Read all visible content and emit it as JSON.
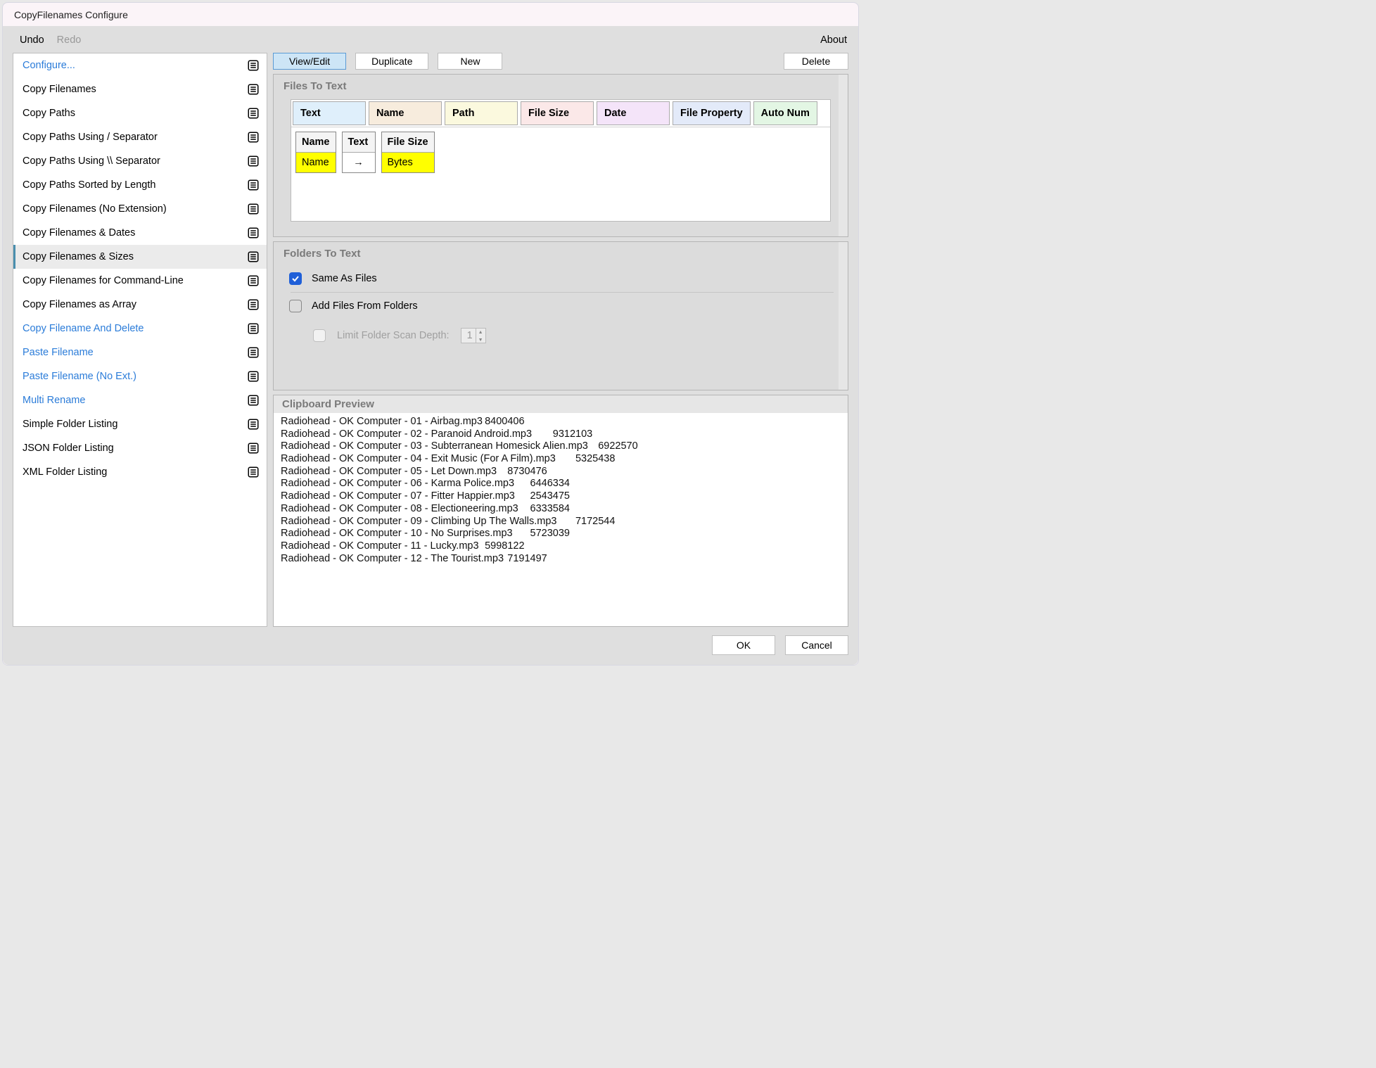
{
  "window_title": "CopyFilenames Configure",
  "menu": {
    "undo": "Undo",
    "redo": "Redo",
    "about": "About"
  },
  "sidebar": {
    "items": [
      {
        "label": "Configure...",
        "link": true
      },
      {
        "label": "Copy Filenames"
      },
      {
        "label": "Copy Paths"
      },
      {
        "label": "Copy Paths Using / Separator"
      },
      {
        "label": "Copy Paths Using \\\\ Separator"
      },
      {
        "label": "Copy Paths Sorted by Length"
      },
      {
        "label": "Copy Filenames (No Extension)"
      },
      {
        "label": "Copy Filenames & Dates"
      },
      {
        "label": "Copy Filenames & Sizes",
        "selected": true
      },
      {
        "label": "Copy Filenames for Command-Line"
      },
      {
        "label": "Copy Filenames as Array"
      },
      {
        "label": "Copy Filename And Delete",
        "link": true
      },
      {
        "label": "Paste Filename",
        "link": true
      },
      {
        "label": "Paste Filename (No Ext.)",
        "link": true
      },
      {
        "label": "Multi Rename",
        "link": true
      },
      {
        "label": "Simple Folder Listing"
      },
      {
        "label": "JSON Folder Listing"
      },
      {
        "label": "XML Folder Listing"
      }
    ]
  },
  "toolbar": {
    "view_edit": "View/Edit",
    "duplicate": "Duplicate",
    "new": "New",
    "delete": "Delete"
  },
  "files_panel": {
    "title": "Files To Text",
    "headers": {
      "text": "Text",
      "name": "Name",
      "path": "Path",
      "size": "File Size",
      "date": "Date",
      "prop": "File Property",
      "anum": "Auto Num"
    },
    "sequence": [
      {
        "head": "Name",
        "val": "Name"
      },
      {
        "head": "Text",
        "val": "→",
        "arrow": true
      },
      {
        "head": "File Size",
        "val": "Bytes"
      }
    ]
  },
  "folders_panel": {
    "title": "Folders To Text",
    "same_as_files": "Same As Files",
    "add_files": "Add Files From Folders",
    "limit_depth": "Limit Folder Scan Depth:",
    "depth_value": "1"
  },
  "preview": {
    "title": "Clipboard Preview",
    "lines": [
      "Radiohead - OK Computer - 01 - Airbag.mp3\t8400406",
      "Radiohead - OK Computer - 02 - Paranoid Android.mp3\t9312103",
      "Radiohead - OK Computer - 03 - Subterranean Homesick Alien.mp3\t6922570",
      "Radiohead - OK Computer - 04 - Exit Music (For A Film).mp3\t5325438",
      "Radiohead - OK Computer - 05 - Let Down.mp3\t8730476",
      "Radiohead - OK Computer - 06 - Karma Police.mp3\t6446334",
      "Radiohead - OK Computer - 07 - Fitter Happier.mp3\t2543475",
      "Radiohead - OK Computer - 08 - Electioneering.mp3\t6333584",
      "Radiohead - OK Computer - 09 - Climbing Up The Walls.mp3\t7172544",
      "Radiohead - OK Computer - 10 - No Surprises.mp3\t5723039",
      "Radiohead - OK Computer - 11 - Lucky.mp3\t5998122",
      "Radiohead - OK Computer - 12 - The Tourist.mp3\t7191497"
    ]
  },
  "buttons": {
    "ok": "OK",
    "cancel": "Cancel"
  }
}
